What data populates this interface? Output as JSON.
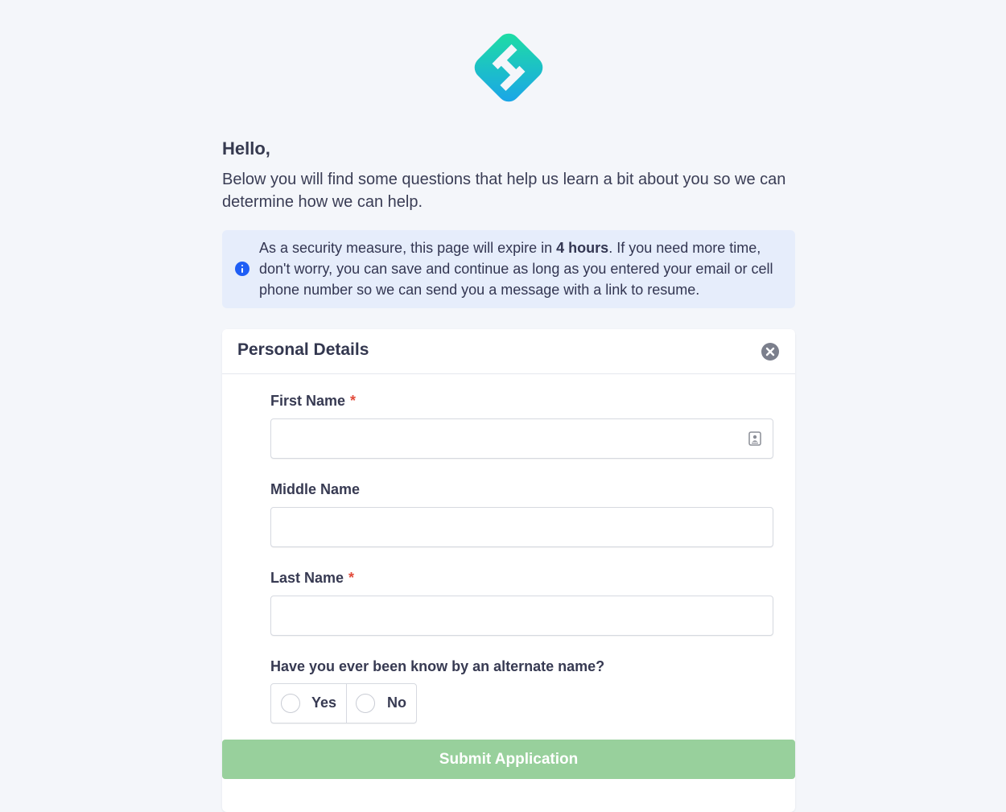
{
  "header": {
    "logo_icon": "brand-logo-icon",
    "brand_gradient": [
      "#19d7a4",
      "#1ca8e6"
    ]
  },
  "intro": {
    "greeting": "Hello,",
    "text": "Below you will find some questions that help us learn a bit about you so we can determine how we can help."
  },
  "notice": {
    "icon": "info-icon",
    "text_before": "As a security measure, this page will expire in ",
    "emphasis": "4 hours",
    "text_after": ". If you need more time, don't worry, you can save and continue as long as you entered your email or cell phone number so we can send you a message with a link to resume.",
    "background_color": "#e6edfb",
    "icon_color": "#1f5ef5"
  },
  "section": {
    "title": "Personal Details",
    "close_icon": "close-circle-icon"
  },
  "fields": {
    "first_name": {
      "label": "First Name",
      "required_mark": "*",
      "value": ""
    },
    "middle_name": {
      "label": "Middle Name",
      "value": ""
    },
    "last_name": {
      "label": "Last Name",
      "required_mark": "*",
      "value": ""
    }
  },
  "alternate_name": {
    "question": "Have you ever been know by an alternate name?",
    "options": [
      {
        "label": "Yes",
        "selected": false
      },
      {
        "label": "No",
        "selected": false
      }
    ]
  },
  "actions": {
    "submit_label": "Submit Application",
    "submit_color": "#98d09c"
  }
}
